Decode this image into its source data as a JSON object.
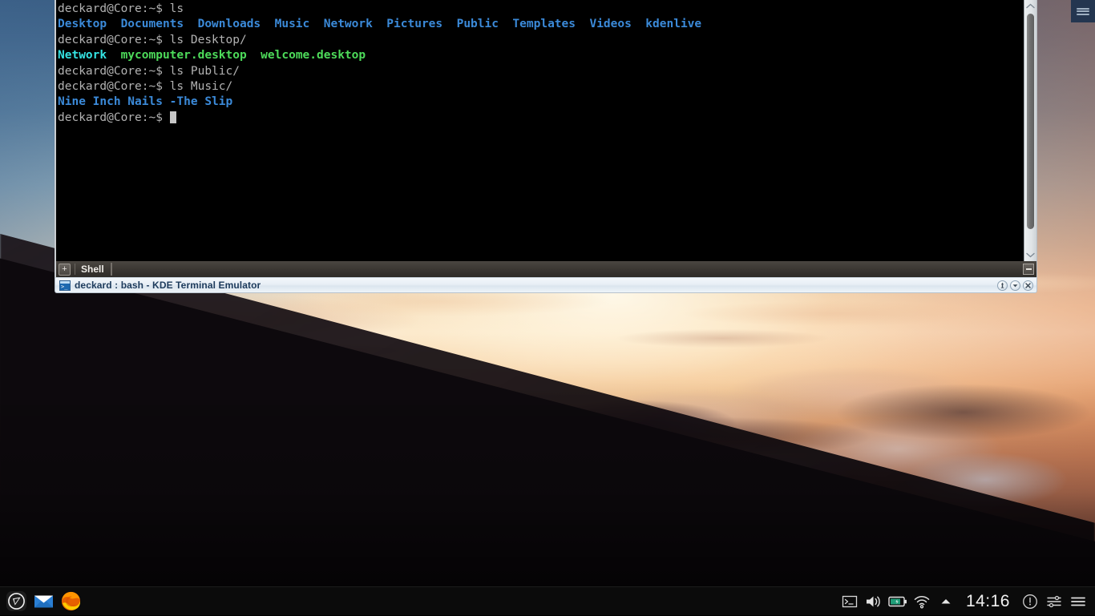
{
  "desktop": {
    "wallpaper_description": "sunset over clouds with dark mountain ridge silhouette",
    "colors": {
      "sky_top": "#35587f",
      "sky_mid": "#fbeed7",
      "sky_warm": "#dfa379",
      "mountain": "#0d090d",
      "taskbar_bg": "#0b0b0b",
      "corner_panel": "#243650"
    }
  },
  "corner_menu": {
    "icon": "hamburger-menu-icon"
  },
  "terminal": {
    "title": "deckard : bash - KDE Terminal Emulator",
    "title_icon": "konsole-icon",
    "tab": {
      "new_tab_label": "+",
      "label": "Shell",
      "minimize_label": "—"
    },
    "window_buttons": [
      {
        "name": "keep-above-button",
        "icon": "pin-icon"
      },
      {
        "name": "window-menu-button",
        "icon": "chevron-down-icon"
      },
      {
        "name": "close-button",
        "icon": "close-x-icon"
      }
    ],
    "scrollbar": {
      "up_icon": "chevron-up-icon",
      "down_icon": "chevron-down-icon",
      "thumb_position_percent": 100
    },
    "lines": [
      {
        "id": "line-1",
        "segments": [
          {
            "text": "deckard@Core:~$ ls",
            "style": "prompt"
          }
        ]
      },
      {
        "id": "line-2",
        "segments": [
          {
            "text": "Desktop  Documents  Downloads  Music  Network  Pictures  Public  Templates  Videos  kdenlive",
            "style": "dir"
          }
        ]
      },
      {
        "id": "line-3",
        "segments": [
          {
            "text": "deckard@Core:~$ ls Desktop/",
            "style": "prompt"
          }
        ]
      },
      {
        "id": "line-4",
        "segments": [
          {
            "text": "Network",
            "style": "cyan"
          },
          {
            "text": "  ",
            "style": "prompt"
          },
          {
            "text": "mycomputer.desktop  welcome.desktop",
            "style": "green"
          }
        ]
      },
      {
        "id": "line-5",
        "segments": [
          {
            "text": "deckard@Core:~$ ls Public/",
            "style": "prompt"
          }
        ]
      },
      {
        "id": "line-6",
        "segments": [
          {
            "text": "deckard@Core:~$ ls Music/",
            "style": "prompt"
          }
        ]
      },
      {
        "id": "line-7",
        "segments": [
          {
            "text": "Nine Inch Nails -The Slip",
            "style": "blue"
          }
        ]
      },
      {
        "id": "line-8",
        "segments": [
          {
            "text": "deckard@Core:~$ ",
            "style": "prompt"
          }
        ],
        "cursor": true
      }
    ],
    "text_colors": {
      "prompt": "#b2b2b2",
      "directory": "#3b8ad9",
      "symlink": "#34e2e2",
      "executable": "#4ddb5a",
      "background": "#000000"
    }
  },
  "taskbar": {
    "launchers": [
      {
        "name": "app-launcher-button",
        "icon": "kde-launcher-icon",
        "label": "Application Launcher"
      },
      {
        "name": "mail-launcher-button",
        "icon": "mail-icon",
        "label": "Mail"
      },
      {
        "name": "firefox-launcher-button",
        "icon": "firefox-icon",
        "label": "Firefox"
      }
    ],
    "tray": [
      {
        "name": "tray-terminal",
        "icon": "terminal-icon"
      },
      {
        "name": "tray-volume",
        "icon": "speaker-icon"
      },
      {
        "name": "tray-battery",
        "icon": "battery-plug-icon"
      },
      {
        "name": "tray-network",
        "icon": "wifi-icon"
      },
      {
        "name": "tray-expand",
        "icon": "chevron-up-icon"
      }
    ],
    "clock": "14:16",
    "tray_right": [
      {
        "name": "tray-notifications",
        "icon": "info-circle-icon"
      },
      {
        "name": "tray-settings",
        "icon": "sliders-icon"
      },
      {
        "name": "tray-menu",
        "icon": "hamburger-menu-icon"
      }
    ]
  }
}
